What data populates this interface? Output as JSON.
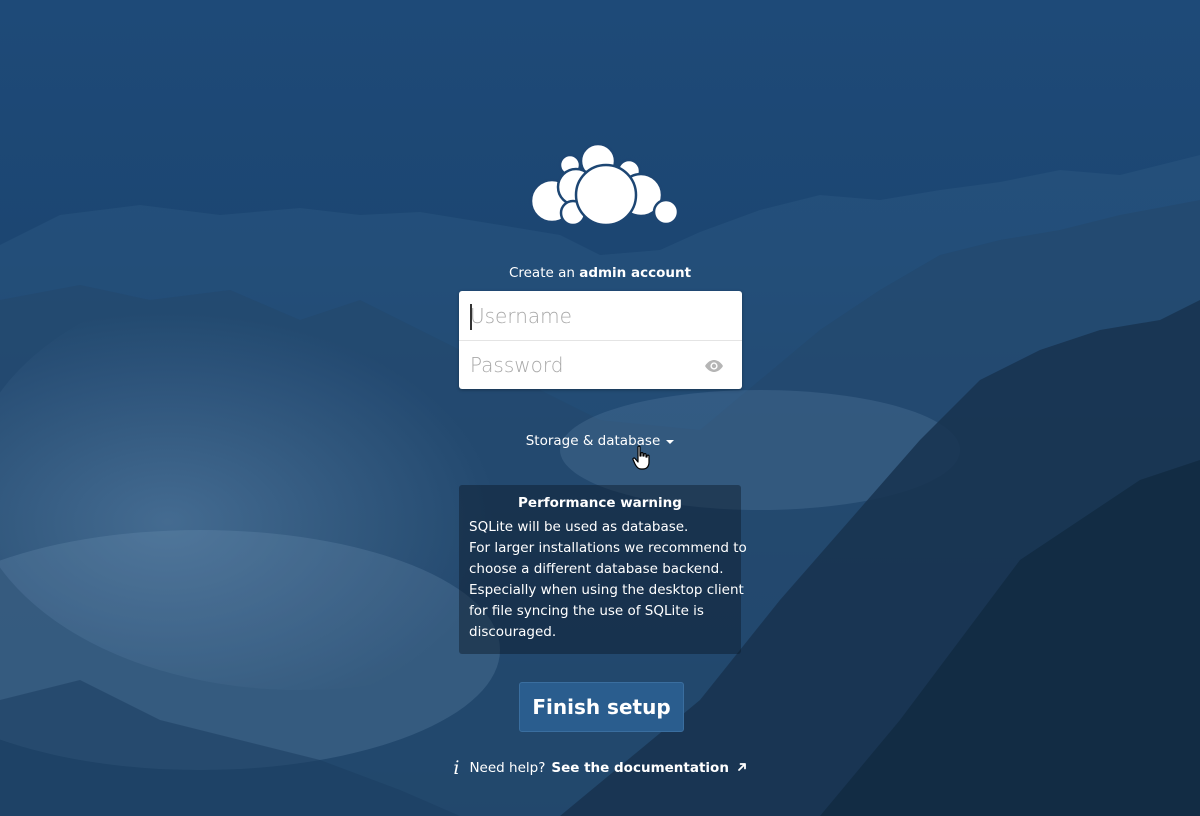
{
  "heading": {
    "prefix": "Create an",
    "emphasis": "admin account"
  },
  "form": {
    "username_placeholder": "Username",
    "username_value": "",
    "password_placeholder": "Password",
    "password_value": "",
    "show_password_icon": "eye-icon"
  },
  "storage_toggle": {
    "label": "Storage & database",
    "icon": "caret-down-icon"
  },
  "warning": {
    "title": "Performance warning",
    "lines": [
      "SQLite will be used as database.",
      "For larger installations we recommend to",
      "choose a different database backend.",
      "Especially when using the desktop client",
      "for file syncing the use of SQLite is",
      "discouraged."
    ]
  },
  "finish_button": {
    "label": "Finish setup"
  },
  "help": {
    "prefix": "Need help?",
    "link_label": "See the documentation",
    "info_icon": "info-icon",
    "external_icon": "external-link-arrow-icon"
  },
  "colors": {
    "background": "#1d4673",
    "button": "#2a5d8e",
    "warning_bg": "#0a1828",
    "text": "#ffffff"
  }
}
